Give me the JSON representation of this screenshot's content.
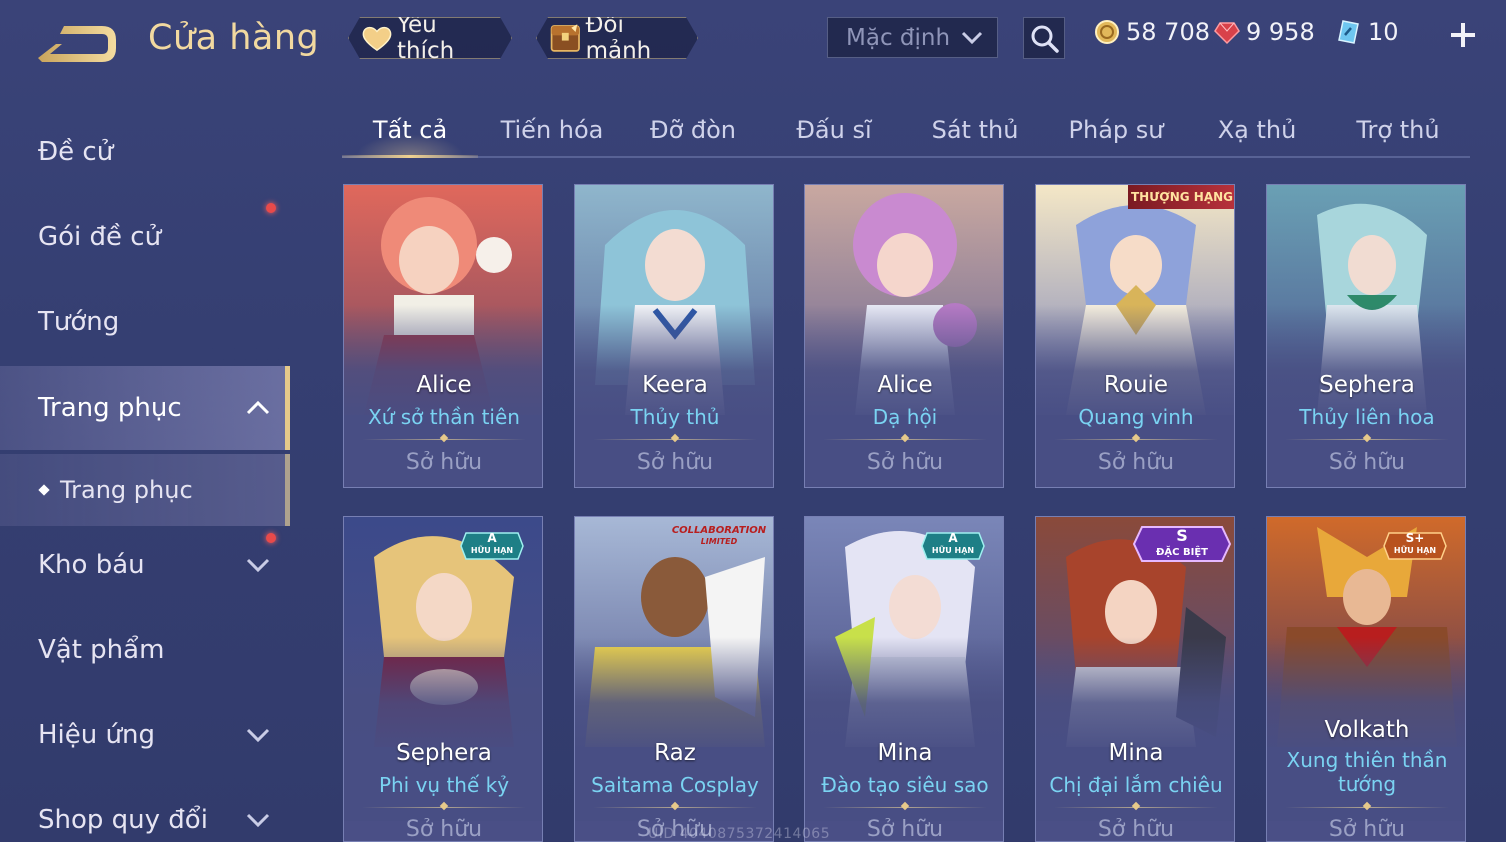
{
  "header": {
    "title": "Cửa hàng",
    "favorite_label": "Yêu thích",
    "exchange_label": "Đổi mảnh",
    "sort_value": "Mặc định",
    "currencies": {
      "gold": "58 708",
      "ruby": "9 958",
      "voucher": "10"
    }
  },
  "sidebar": {
    "items": [
      {
        "label": "Đề cử"
      },
      {
        "label": "Gói đề cử"
      },
      {
        "label": "Tướng"
      },
      {
        "label": "Trang phục"
      },
      {
        "label": "Trang phục"
      },
      {
        "label": "Kho báu"
      },
      {
        "label": "Vật phẩm"
      },
      {
        "label": "Hiệu ứng"
      },
      {
        "label": "Shop quy đổi"
      }
    ]
  },
  "tabs": [
    {
      "label": "Tất cả"
    },
    {
      "label": "Tiến hóa"
    },
    {
      "label": "Đỡ đòn"
    },
    {
      "label": "Đấu sĩ"
    },
    {
      "label": "Sát thủ"
    },
    {
      "label": "Pháp sư"
    },
    {
      "label": "Xạ thủ"
    },
    {
      "label": "Trợ thủ"
    }
  ],
  "cards": [
    {
      "hero": "Alice",
      "skin": "Xứ sở thần tiên",
      "status": "Sở hữu"
    },
    {
      "hero": "Keera",
      "skin": "Thủy thủ",
      "status": "Sở hữu"
    },
    {
      "hero": "Alice",
      "skin": "Dạ hội",
      "status": "Sở hữu"
    },
    {
      "hero": "Rouie",
      "skin": "Quang vinh",
      "status": "Sở hữu",
      "badge": "THƯỢNG HẠNG"
    },
    {
      "hero": "Sephera",
      "skin": "Thủy liên hoa",
      "status": "Sở hữu"
    },
    {
      "hero": "Sephera",
      "skin": "Phi vụ thế kỷ",
      "status": "Sở hữu",
      "badge_grade": "A",
      "badge_sub": "HỮU HẠN"
    },
    {
      "hero": "Raz",
      "skin": "Saitama Cosplay",
      "status": "Sở hữu",
      "badge": "COLLABORATION",
      "badge_sub": "LIMITED"
    },
    {
      "hero": "Mina",
      "skin": "Đào tạo siêu sao",
      "status": "Sở hữu",
      "badge_grade": "A",
      "badge_sub": "HỮU HẠN"
    },
    {
      "hero": "Mina",
      "skin": "Chị đại lắm chiêu",
      "status": "Sở hữu",
      "badge_grade": "S",
      "badge_sub": "ĐẶC BIỆT"
    },
    {
      "hero": "Volkath",
      "skin": "Xung thiên thần tướng",
      "status": "Sở hữu",
      "badge_grade": "S+",
      "badge_sub": "HỮU HẠN"
    }
  ],
  "watermark": "UID 4040875372414065"
}
